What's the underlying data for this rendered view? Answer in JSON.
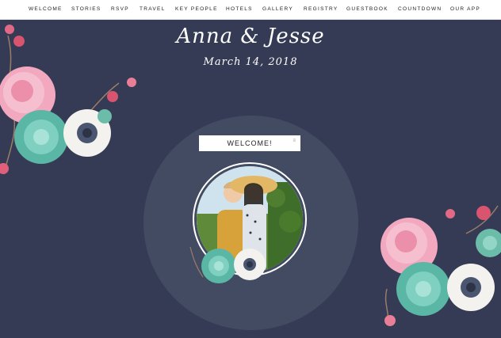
{
  "nav": {
    "items": [
      {
        "label": "WELCOME"
      },
      {
        "label": "STORIES"
      },
      {
        "label": "RSVP"
      },
      {
        "label": "TRAVEL"
      },
      {
        "label": "KEY PEOPLE"
      },
      {
        "label": "HOTELS"
      },
      {
        "label": "GALLERY"
      },
      {
        "label": "REGISTRY"
      },
      {
        "label": "GUESTBOOK"
      },
      {
        "label": "COUNTDOWN"
      },
      {
        "label": "OUR APP"
      }
    ]
  },
  "header": {
    "names": "Anna & Jesse",
    "date": "March 14, 2018"
  },
  "hero": {
    "welcome_label": "WELCOME!",
    "welcome_marker": "≡"
  },
  "colors": {
    "background": "#353b55",
    "circle": "#424b62",
    "nav_background": "#ffffff"
  },
  "decor": {
    "floral_top_left": "floral-bouquet",
    "floral_right": "floral-bouquet",
    "floral_photo": "floral-bouquet"
  }
}
